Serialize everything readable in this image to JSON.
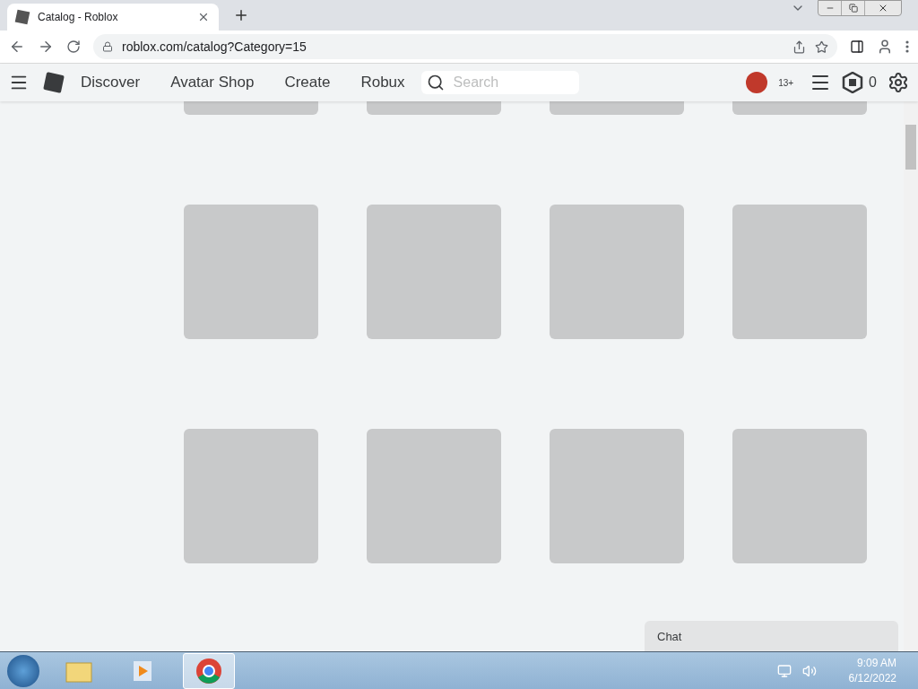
{
  "browser": {
    "tab_title": "Catalog - Roblox",
    "address": "roblox.com/catalog?Category=15"
  },
  "nav": {
    "items": [
      "Discover",
      "Avatar Shop",
      "Create",
      "Robux"
    ],
    "search": {
      "placeholder": "Search"
    },
    "age_badge": "13+",
    "robux_balance": "0"
  },
  "chat": {
    "label": "Chat"
  },
  "taskbar": {
    "time": "9:09 AM",
    "date": "6/12/2022"
  }
}
